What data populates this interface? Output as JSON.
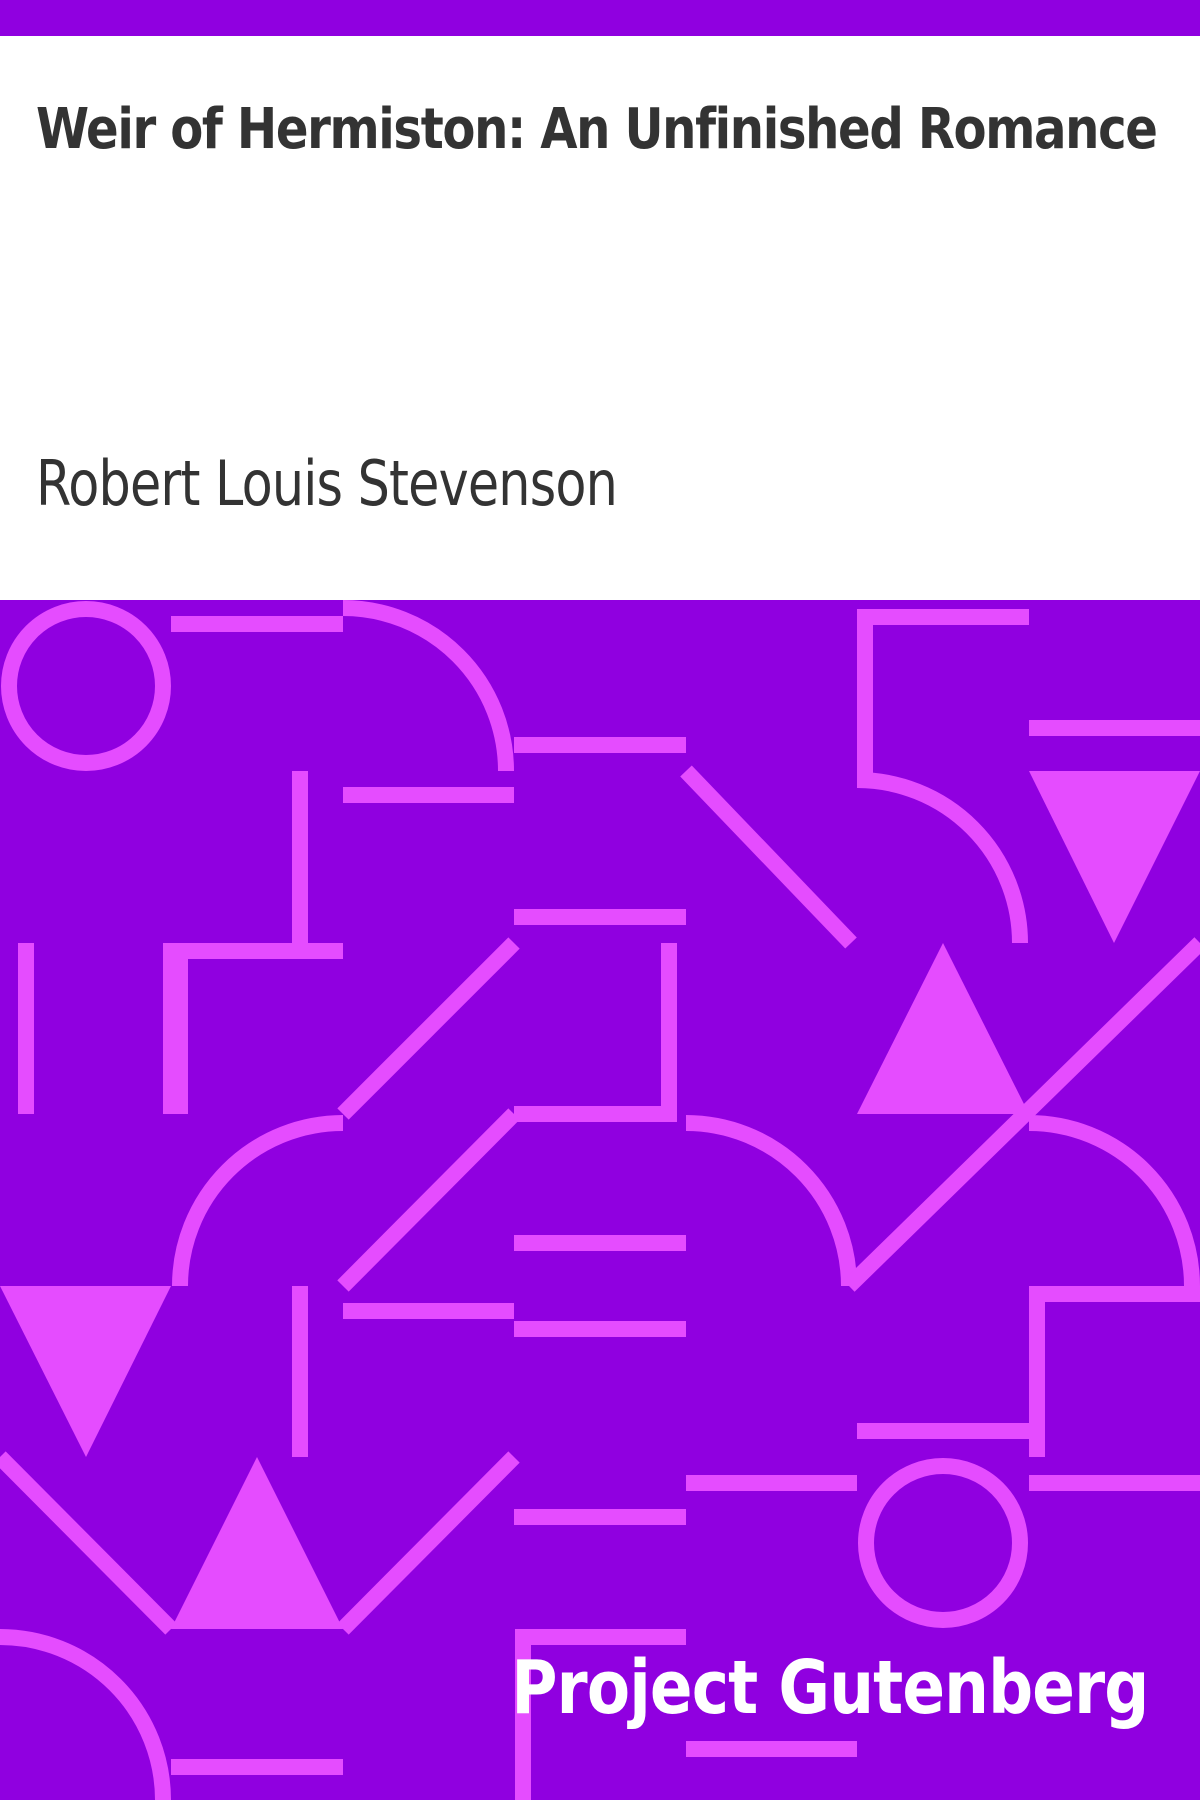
{
  "book": {
    "title": "Weir of Hermiston: An Unfinished Romance",
    "author": "Robert Louis Stevenson"
  },
  "publisher": {
    "name": "Project Gutenberg"
  },
  "colors": {
    "background": "#9000e0",
    "pattern": "#e54cff",
    "text": "#333333",
    "page": "#ffffff",
    "brand_text": "#ffffff"
  }
}
